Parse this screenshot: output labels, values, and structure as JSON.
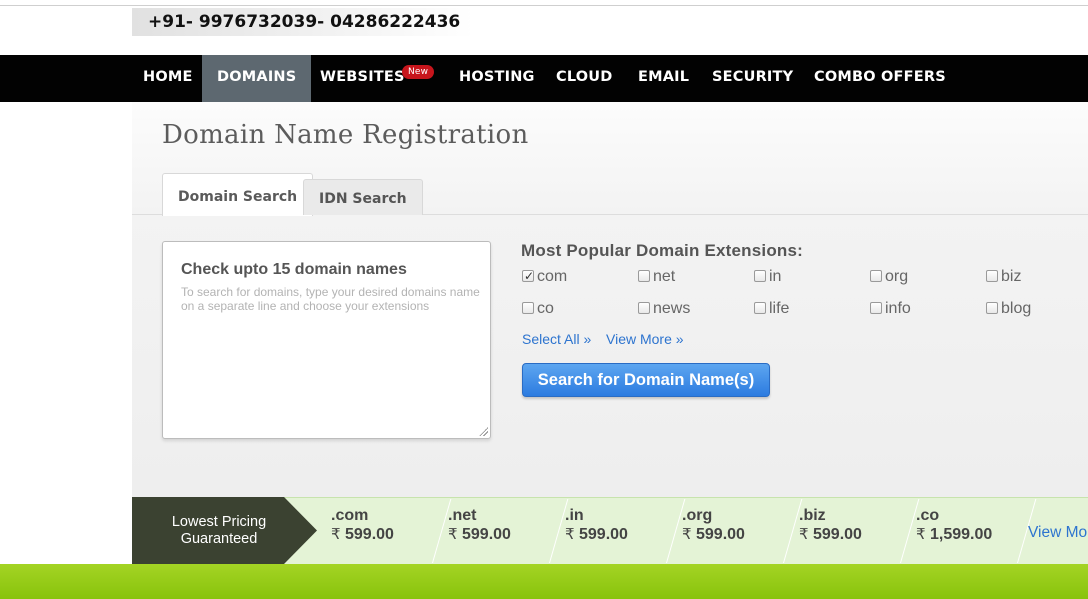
{
  "header": {
    "phone": "+91- 9976732039- 04286222436"
  },
  "nav": {
    "items": [
      {
        "label": "HOME"
      },
      {
        "label": "DOMAINS"
      },
      {
        "label": "WEBSITES"
      },
      {
        "label": "HOSTING"
      },
      {
        "label": "CLOUD"
      },
      {
        "label": "EMAIL"
      },
      {
        "label": "SECURITY"
      },
      {
        "label": "COMBO OFFERS"
      }
    ],
    "active": "DOMAINS",
    "badge": "New"
  },
  "page": {
    "title": "Domain Name Registration"
  },
  "tabs": [
    {
      "label": "Domain Search",
      "active": true
    },
    {
      "label": "IDN Search",
      "active": false
    }
  ],
  "search": {
    "title": "Check upto 15 domain names",
    "placeholder": "To search for domains, type your desired domains name on a separate line and choose your extensions",
    "value": ""
  },
  "extensions": {
    "heading": "Most Popular Domain Extensions:",
    "items": [
      {
        "label": "com",
        "checked": true
      },
      {
        "label": "net",
        "checked": false
      },
      {
        "label": "in",
        "checked": false
      },
      {
        "label": "org",
        "checked": false
      },
      {
        "label": "biz",
        "checked": false
      },
      {
        "label": "co",
        "checked": false
      },
      {
        "label": "news",
        "checked": false
      },
      {
        "label": "life",
        "checked": false
      },
      {
        "label": "info",
        "checked": false
      },
      {
        "label": "blog",
        "checked": false
      }
    ],
    "select_all": "Select All »",
    "view_more": "View More »",
    "button": "Search for Domain Name(s)"
  },
  "pricing": {
    "label_line1": "Lowest Pricing",
    "label_line2": "Guaranteed",
    "currency": "₹",
    "items": [
      {
        "ext": ".com",
        "price": "599.00"
      },
      {
        "ext": ".net",
        "price": "599.00"
      },
      {
        "ext": ".in",
        "price": "599.00"
      },
      {
        "ext": ".org",
        "price": "599.00"
      },
      {
        "ext": ".biz",
        "price": "599.00"
      },
      {
        "ext": ".co",
        "price": "1,599.00"
      }
    ],
    "view_more": "View More"
  },
  "colors": {
    "nav_bg": "#020202",
    "nav_active": "#5d6870",
    "badge": "#c7151c",
    "button": "#2c7be0",
    "link": "#2d74cf",
    "pricing_bg": "#e4f3d6",
    "pricing_label_bg": "#3b4231",
    "footer_green": "#94c91a"
  }
}
